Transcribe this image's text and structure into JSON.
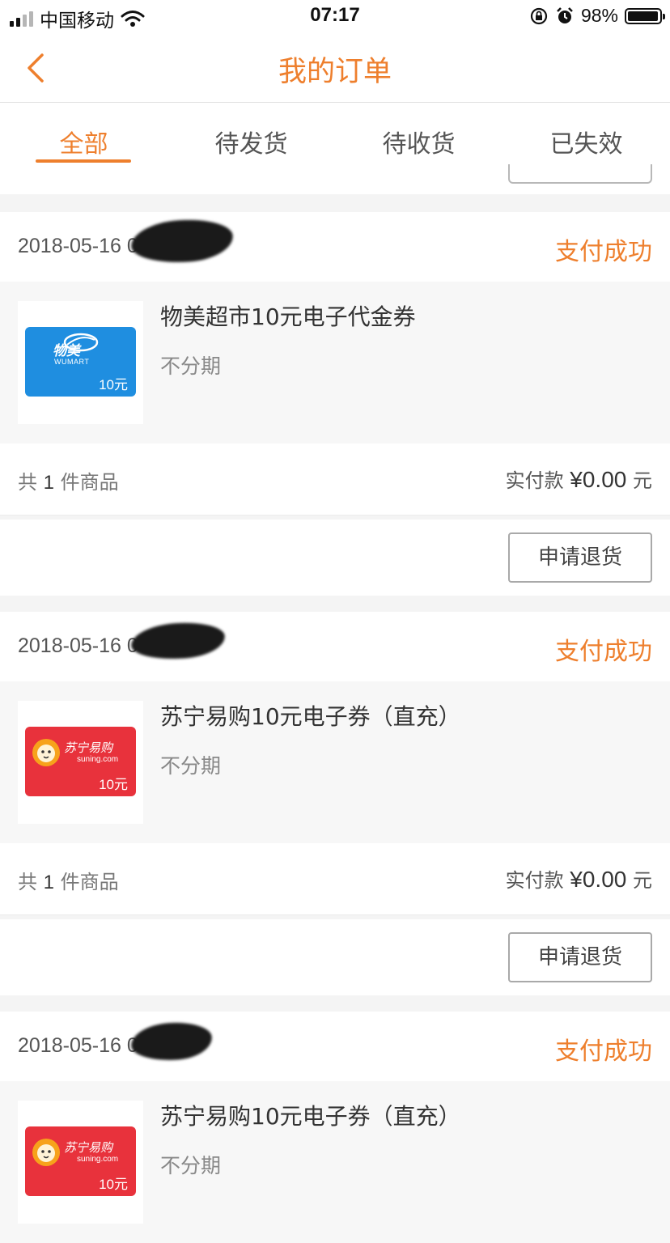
{
  "status_bar": {
    "carrier": "中国移动",
    "time": "07:17",
    "battery": "98%",
    "battery_level": 0.98
  },
  "header": {
    "title": "我的订单"
  },
  "tabs": [
    {
      "label": "全部",
      "active": true
    },
    {
      "label": "待发货",
      "active": false
    },
    {
      "label": "待收货",
      "active": false
    },
    {
      "label": "已失效",
      "active": false
    }
  ],
  "orders": [
    {
      "date": "2018-05-16 07:1",
      "status": "支付成功",
      "item_title": "物美超市10元电子代金券",
      "item_subtitle": "不分期",
      "card_brand": "物美",
      "card_brand_sub": "WUMART",
      "card_price": "10元",
      "summary_prefix": "共",
      "count": "1",
      "summary_suffix": "件商品",
      "paid_label": "实付款",
      "paid_amount": "¥0.00",
      "currency_unit": "元",
      "action": "申请退货"
    },
    {
      "date": "2018-05-16 07:07:55",
      "status": "支付成功",
      "item_title": "苏宁易购10元电子券（直充）",
      "item_subtitle": "不分期",
      "card_brand": "苏宁易购",
      "card_brand_sub": "suning.com",
      "card_price": "10元",
      "summary_prefix": "共",
      "count": "1",
      "summary_suffix": "件商品",
      "paid_label": "实付款",
      "paid_amount": "¥0.00",
      "currency_unit": "元",
      "action": "申请退货"
    },
    {
      "date": "2018-05-16 07:",
      "status": "支付成功",
      "item_title": "苏宁易购10元电子券（直充）",
      "item_subtitle": "不分期",
      "card_brand": "苏宁易购",
      "card_brand_sub": "suning.com",
      "card_price": "10元"
    }
  ]
}
